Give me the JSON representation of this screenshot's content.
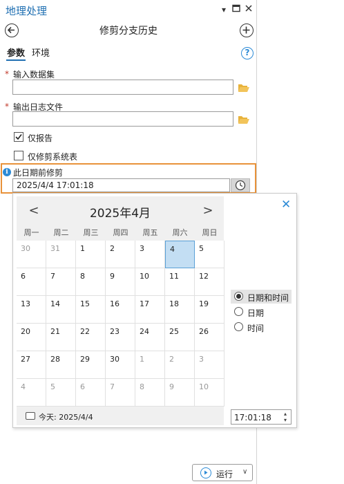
{
  "app": {
    "panel_title": "地理处理"
  },
  "tool": {
    "title": "修剪分支历史"
  },
  "tabs": [
    {
      "label": "参数",
      "active": true
    },
    {
      "label": "环境",
      "active": false
    }
  ],
  "params": {
    "input_dataset": {
      "label": "输入数据集",
      "required_mark": "*",
      "value": ""
    },
    "output_log": {
      "label": "输出日志文件",
      "required_mark": "*",
      "value": ""
    },
    "report_only": {
      "label": "仅报告",
      "checked": true
    },
    "trim_system_tables": {
      "label": "仅修剪系统表",
      "checked": false
    },
    "trim_before_date": {
      "label": "此日期前修剪",
      "value": "2025/4/4 17:01:18"
    }
  },
  "calendar": {
    "month_title": "2025年4月",
    "weekdays": [
      "周一",
      "周二",
      "周三",
      "周四",
      "周五",
      "周六",
      "周日"
    ],
    "weeks": [
      [
        "30",
        "31",
        "1",
        "2",
        "3",
        "4",
        "5"
      ],
      [
        "6",
        "7",
        "8",
        "9",
        "10",
        "11",
        "12"
      ],
      [
        "13",
        "14",
        "15",
        "16",
        "17",
        "18",
        "19"
      ],
      [
        "20",
        "21",
        "22",
        "23",
        "24",
        "25",
        "26"
      ],
      [
        "27",
        "28",
        "29",
        "30",
        "1",
        "2",
        "3"
      ],
      [
        "4",
        "5",
        "6",
        "7",
        "8",
        "9",
        "10"
      ]
    ],
    "selected_day": "4",
    "today_label": "今天: 2025/4/4"
  },
  "mode_options": [
    {
      "label": "日期和时间",
      "selected": true
    },
    {
      "label": "日期",
      "selected": false
    },
    {
      "label": "时间",
      "selected": false
    }
  ],
  "time_value": "17:01:18",
  "run_label": "运行",
  "colors": {
    "accent": "#1f6fb2",
    "highlight_border": "#e8923a",
    "selected_day": "#c3def3"
  }
}
